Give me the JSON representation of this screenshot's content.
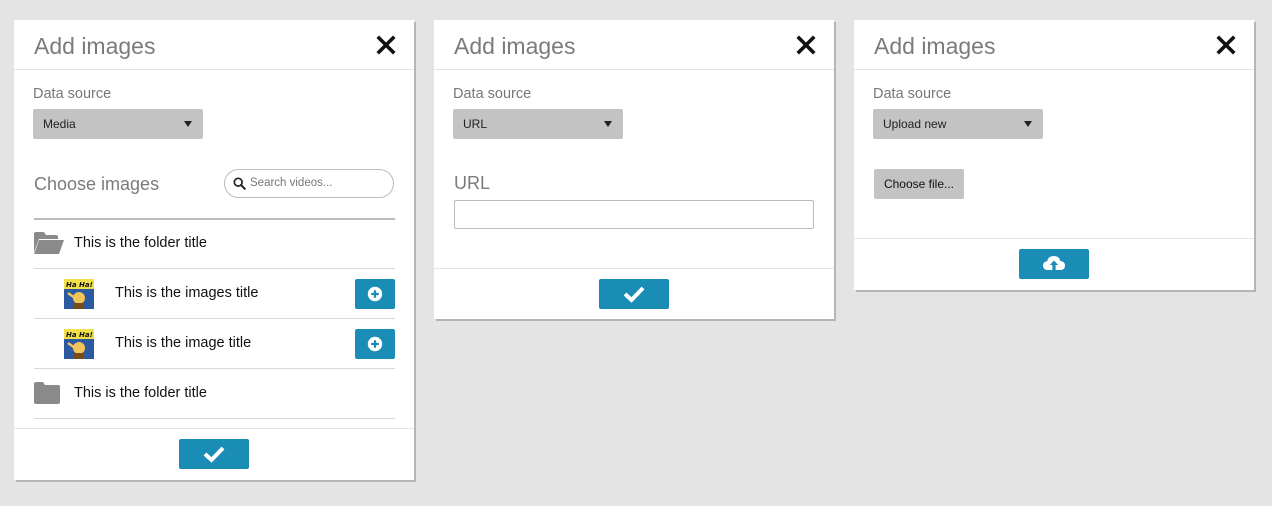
{
  "colors": {
    "accent": "#1a8db6",
    "select_bg": "#c3c3c3",
    "page_bg": "#e4e4e4"
  },
  "dialogs": [
    {
      "title": "Add images",
      "close_icon": "close-icon",
      "data_source_label": "Data source",
      "data_source_value": "Media",
      "choose_title": "Choose images",
      "search_placeholder": "Search videos...",
      "items": [
        {
          "type": "folder",
          "icon": "folder-open-icon",
          "label": "This is the folder title"
        },
        {
          "type": "image",
          "icon": "image-thumbnail",
          "label": "This is the images title",
          "action_icon": "plus-circle-icon"
        },
        {
          "type": "image",
          "icon": "image-thumbnail",
          "label": "This is the image title",
          "action_icon": "plus-circle-icon"
        },
        {
          "type": "folder",
          "icon": "folder-closed-icon",
          "label": "This is the folder title"
        }
      ],
      "confirm_icon": "check-icon"
    },
    {
      "title": "Add images",
      "close_icon": "close-icon",
      "data_source_label": "Data source",
      "data_source_value": "URL",
      "url_label": "URL",
      "url_value": "",
      "confirm_icon": "check-icon"
    },
    {
      "title": "Add images",
      "close_icon": "close-icon",
      "data_source_label": "Data source",
      "data_source_value": "Upload new",
      "choose_file_label": "Choose file...",
      "confirm_icon": "cloud-upload-icon"
    }
  ]
}
